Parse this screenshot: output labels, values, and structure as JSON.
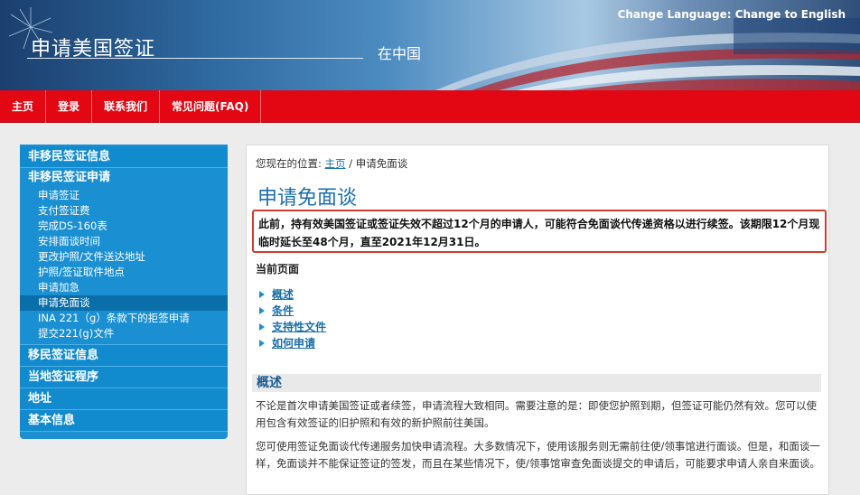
{
  "header": {
    "title": "申请美国签证",
    "subtitle": "在中国",
    "change_language_label": "Change Language:",
    "change_language_link": "Change to English"
  },
  "nav": {
    "items": [
      "主页",
      "登录",
      "联系我们",
      "常见问题(FAQ)"
    ]
  },
  "sidebar": {
    "section_nonimmigrant_info": "非移民签证信息",
    "group_head": "非移民签证申请",
    "sub_items": [
      "申请签证",
      "支付签证费",
      "完成DS-160表",
      "安排面谈时间",
      "更改护照/文件送达地址",
      "护照/签证取件地点",
      "申请加急",
      "申请免面谈",
      "INA 221（g）条款下的拒签申请",
      "提交221(g)文件"
    ],
    "active_index": 7,
    "sections_after": [
      "移民签证信息",
      "当地签证程序",
      "地址",
      "基本信息"
    ]
  },
  "content": {
    "breadcrumb_prefix": "您现在的位置:",
    "breadcrumb_home": "主页",
    "breadcrumb_sep": "/",
    "breadcrumb_current": "申请免面谈",
    "page_title": "申请免面谈",
    "notice_text": "此前，持有效美国签证或签证失效不超过12个月的申请人，可能符合免面谈代传递资格以进行续签。该期限12个月现临时延长至48个月，直至2021年12月31日。",
    "current_page_label": "当前页面",
    "toc": [
      "概述",
      "条件",
      "支持性文件",
      "如何申请"
    ],
    "section_title": "概述",
    "para1": "不论是首次申请美国签证或者续签，申请流程大致相同。需要注意的是：即使您护照到期，但签证可能仍然有效。您可以使用包含有效签证的旧护照和有效的新护照前往美国。",
    "para2": "您可使用签证免面谈代传递服务加快申请流程。大多数情况下，使用该服务则无需前往使/领事馆进行面谈。但是，和面谈一样，免面谈并不能保证签证的签发，而且在某些情况下，使/领事馆审查免面谈提交的申请后，可能要求申请人亲自来面谈。"
  },
  "colors": {
    "nav_red": "#e30613",
    "sidebar_blue": "#1c8fd1",
    "title_blue": "#1c6fb0",
    "notice_border": "#d23b2f"
  }
}
